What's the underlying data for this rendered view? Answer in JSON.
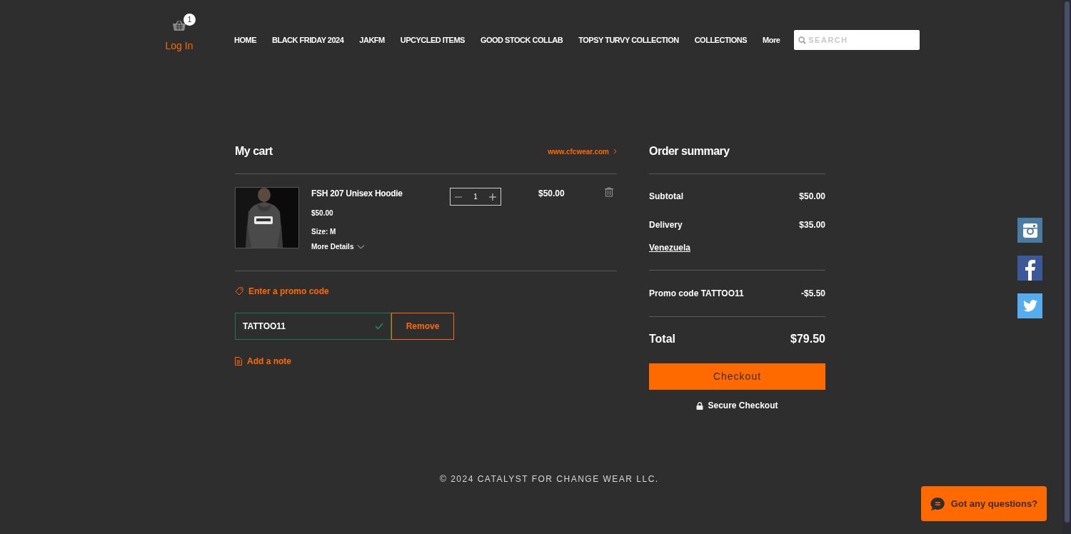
{
  "header": {
    "cart_count": "1",
    "login": "Log In",
    "nav": [
      {
        "label": "HOME"
      },
      {
        "label": "BLACK FRIDAY 2024"
      },
      {
        "label": "JAKFM"
      },
      {
        "label": "UPCYCLED ITEMS"
      },
      {
        "label": "GOOD STOCK COLLAB"
      },
      {
        "label": "TOPSY TURVY COLLECTION"
      },
      {
        "label": "COLLECTIONS"
      },
      {
        "label": "More"
      }
    ],
    "search": {
      "placeholder": "SEARCH"
    }
  },
  "cart": {
    "title": "My cart",
    "site_link": "www.cfcwear.com",
    "items": [
      {
        "name": "FSH 207 Unisex Hoodie",
        "price": "$50.00",
        "size": "Size: M",
        "more": "More Details",
        "quantity": "1",
        "total": "$50.00"
      }
    ],
    "promo": {
      "link": "Enter a promo code",
      "code": "TATTOO11",
      "valid": true,
      "remove": "Remove"
    },
    "note": "Add a note"
  },
  "summary": {
    "title": "Order summary",
    "subtotal": {
      "label": "Subtotal",
      "value": "$50.00"
    },
    "delivery": {
      "label": "Delivery",
      "value": "$35.00",
      "place": "Venezuela"
    },
    "promo": {
      "label": "Promo code TATTOO11",
      "value": "-$5.50"
    },
    "total": {
      "label": "Total",
      "value": "$79.50"
    },
    "checkout": "Checkout",
    "secure": "Secure Checkout"
  },
  "footer": "© 2024 CATALYST FOR CHANGE WEAR LLC.",
  "social": [
    {
      "kind": "instagram"
    },
    {
      "kind": "facebook"
    },
    {
      "kind": "twitter"
    }
  ],
  "chat": "Got any questions?"
}
